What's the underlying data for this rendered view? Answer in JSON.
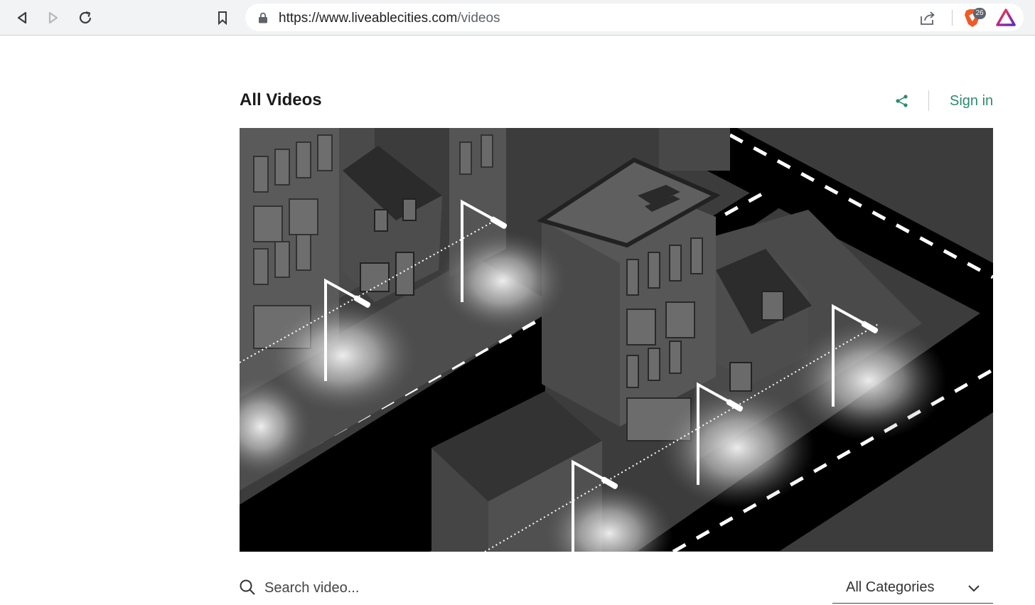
{
  "browser": {
    "url_host": "https://www.liveablecities.com",
    "url_path": "/videos",
    "shields_count": "26"
  },
  "page": {
    "title": "All Videos",
    "sign_in": "Sign in"
  },
  "search": {
    "placeholder": "Search video...",
    "value": ""
  },
  "filter": {
    "selected": "All Categories"
  },
  "colors": {
    "accent": "#2f8a6e",
    "brave": "#f05a24"
  },
  "icons": [
    "back-icon",
    "forward-icon",
    "reload-icon",
    "bookmark-icon",
    "lock-icon",
    "share-icon",
    "brave-shields-icon",
    "brave-rewards-icon",
    "search-icon",
    "chevron-down-icon"
  ]
}
